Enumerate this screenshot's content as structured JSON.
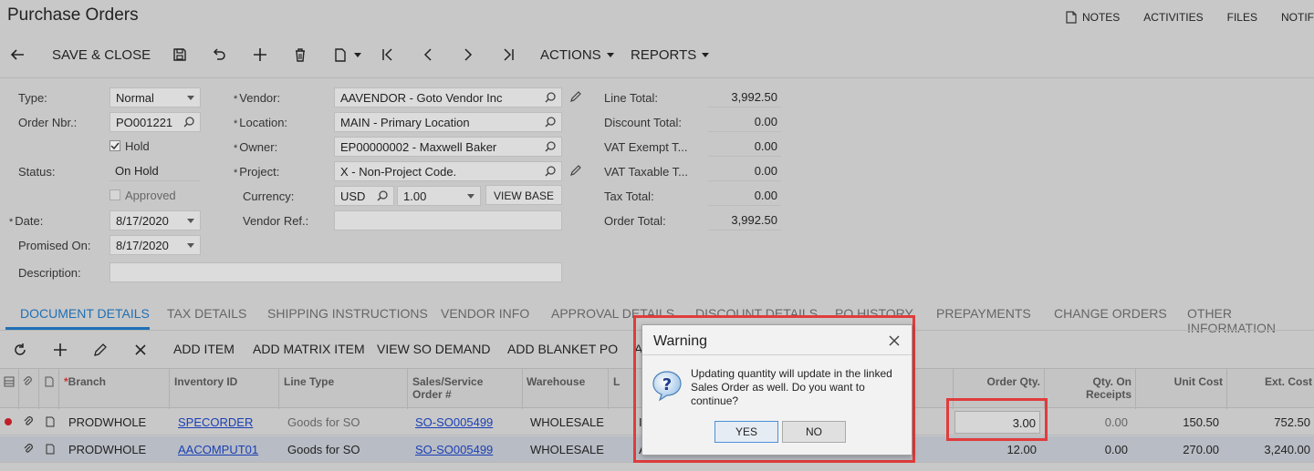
{
  "page": {
    "title": "Purchase Orders"
  },
  "toplinks": {
    "notes": "NOTES",
    "activities": "ACTIVITIES",
    "files": "FILES",
    "notif": "NOTIF"
  },
  "toolbar": {
    "save_close": "SAVE & CLOSE",
    "actions": "ACTIONS",
    "reports": "REPORTS"
  },
  "form": {
    "type_label": "Type:",
    "type_value": "Normal",
    "order_nbr_label": "Order Nbr.:",
    "order_nbr_value": "PO001221",
    "hold_label": "Hold",
    "status_label": "Status:",
    "status_value": "On Hold",
    "approved_label": "Approved",
    "date_label": "Date:",
    "date_value": "8/17/2020",
    "promised_label": "Promised On:",
    "promised_value": "8/17/2020",
    "description_label": "Description:",
    "description_value": "",
    "vendor_label": "Vendor:",
    "vendor_value": "AAVENDOR - Goto Vendor Inc",
    "location_label": "Location:",
    "location_value": "MAIN - Primary Location",
    "owner_label": "Owner:",
    "owner_value": "EP00000002 - Maxwell Baker",
    "project_label": "Project:",
    "project_value": "X - Non-Project Code.",
    "currency_label": "Currency:",
    "currency_value": "USD",
    "rate_value": "1.00",
    "view_base": "VIEW BASE",
    "vendor_ref_label": "Vendor Ref.:",
    "vendor_ref_value": ""
  },
  "totals": [
    {
      "label": "Line Total:",
      "value": "3,992.50"
    },
    {
      "label": "Discount Total:",
      "value": "0.00"
    },
    {
      "label": "VAT Exempt T...",
      "value": "0.00"
    },
    {
      "label": "VAT Taxable T...",
      "value": "0.00"
    },
    {
      "label": "Tax Total:",
      "value": "0.00"
    },
    {
      "label": "Order Total:",
      "value": "3,992.50"
    }
  ],
  "tabs": [
    "DOCUMENT DETAILS",
    "TAX DETAILS",
    "SHIPPING INSTRUCTIONS",
    "VENDOR INFO",
    "APPROVAL DETAILS",
    "DISCOUNT DETAILS",
    "PO HISTORY",
    "PREPAYMENTS",
    "CHANGE ORDERS",
    "OTHER INFORMATION"
  ],
  "grid_toolbar": {
    "add_item": "ADD ITEM",
    "add_matrix_item": "ADD MATRIX ITEM",
    "view_so_demand": "VIEW SO DEMAND",
    "add_blanket_po": "ADD BLANKET PO",
    "truncated": "A"
  },
  "grid": {
    "headers": {
      "branch": "Branch",
      "inventory_id": "Inventory ID",
      "line_type": "Line Type",
      "sales_order_1": "Sales/Service",
      "sales_order_2": "Order #",
      "warehouse": "Warehouse",
      "l": "L",
      "order_qty": "Order Qty.",
      "qty_receipts_1": "Qty. On",
      "qty_receipts_2": "Receipts",
      "unit_cost": "Unit Cost",
      "ext_cost": "Ext. Cost"
    },
    "rows": [
      {
        "branch": "PRODWHOLE",
        "inventory_id": "SPECORDER",
        "line_type": "Goods for SO",
        "sales_order": "SO-SO005499",
        "warehouse": "WHOLESALE",
        "l": "I",
        "order_qty": "3.00",
        "qty_receipts": "0.00",
        "unit_cost": "150.50",
        "ext_cost": "752.50"
      },
      {
        "branch": "PRODWHOLE",
        "inventory_id": "AACOMPUT01",
        "line_type": "Goods for SO",
        "sales_order": "SO-SO005499",
        "warehouse": "WHOLESALE",
        "l": "A",
        "order_qty": "12.00",
        "qty_receipts": "0.00",
        "unit_cost": "270.00",
        "ext_cost": "3,240.00"
      }
    ]
  },
  "dialog": {
    "title": "Warning",
    "message": "Updating quantity will update in the linked Sales Order as well. Do you want to continue?",
    "yes": "YES",
    "no": "NO"
  },
  "colors": {
    "accent": "#1f6fb5",
    "highlight": "#e03c3c",
    "link": "#1a3fb5"
  }
}
